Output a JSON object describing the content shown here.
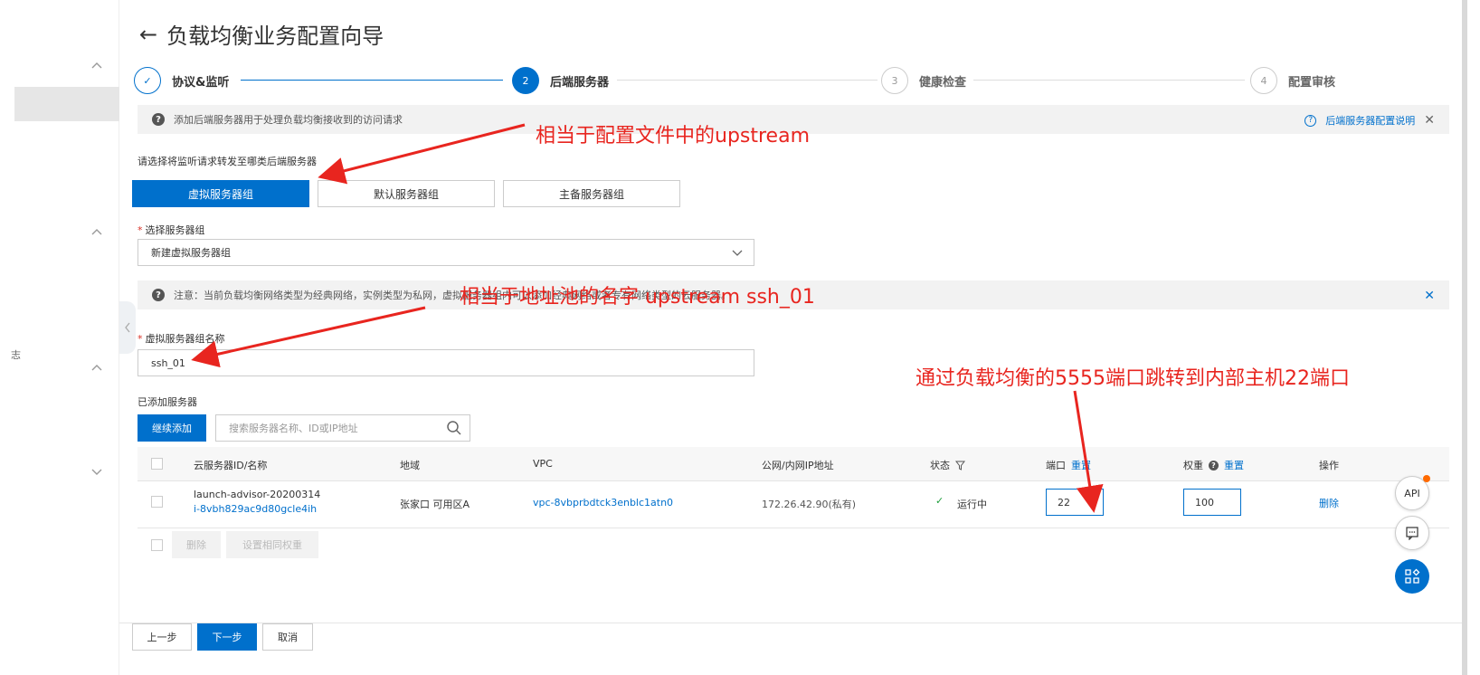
{
  "sidebar": {
    "text": "志"
  },
  "header": {
    "back": "←",
    "title": "负载均衡业务配置向导"
  },
  "steps": [
    {
      "index": "✓",
      "label": "协议&监听",
      "state": "done"
    },
    {
      "index": "2",
      "label": "后端服务器",
      "state": "active"
    },
    {
      "index": "3",
      "label": "健康检查",
      "state": "todo"
    },
    {
      "index": "4",
      "label": "配置审核",
      "state": "todo"
    }
  ],
  "info1": {
    "text": "添加后端服务器用于处理负载均衡接收到的访问请求",
    "help_link": "后端服务器配置说明",
    "close": "✕"
  },
  "forward": {
    "label": "请选择将监听请求转发至哪类后端服务器",
    "options": [
      "虚拟服务器组",
      "默认服务器组",
      "主备服务器组"
    ],
    "selected": "虚拟服务器组"
  },
  "server_group": {
    "label": "选择服务器组",
    "required": "*",
    "value": "新建虚拟服务器组"
  },
  "info2": {
    "text": "注意：当前负载均衡网络类型为经典网络，实例类型为私网，虚拟服务器组内可以添加经典网络或者专有网络类型的云服务器。",
    "close": "✕"
  },
  "group_name": {
    "label": "虚拟服务器组名称",
    "required": "*",
    "value": "ssh_01"
  },
  "added": {
    "label": "已添加服务器",
    "add_button": "继续添加",
    "search_placeholder": "搜索服务器名称、ID或IP地址"
  },
  "table": {
    "headers": {
      "id": "云服务器ID/名称",
      "region": "地域",
      "vpc": "VPC",
      "ip": "公网/内网IP地址",
      "status": "状态",
      "port": "端口",
      "port_reset": "重置",
      "weight": "权重",
      "weight_reset": "重置",
      "action": "操作"
    },
    "rows": [
      {
        "name": "launch-advisor-20200314",
        "id": "i-8vbh829ac9d80gcle4ih",
        "region": "张家口 可用区A",
        "vpc": "vpc-8vbprbdtck3enblc1atn0",
        "ip": "172.26.42.90(私有)",
        "status": "运行中",
        "port": "22",
        "weight": "100",
        "action": "删除"
      }
    ],
    "bulk_delete": "删除",
    "bulk_weight": "设置相同权重"
  },
  "footer": {
    "prev": "上一步",
    "next": "下一步",
    "cancel": "取消"
  },
  "floating": {
    "api": "API"
  },
  "annotations": {
    "a1": "相当于配置文件中的upstream",
    "a2": "相当于地址池的名字 upstream ssh_01",
    "a3": "通过负载均衡的5555端口跳转到内部主机22端口"
  },
  "colors": {
    "primary": "#0070cc",
    "annotation": "#e8251f",
    "success": "#1e9e3c"
  }
}
